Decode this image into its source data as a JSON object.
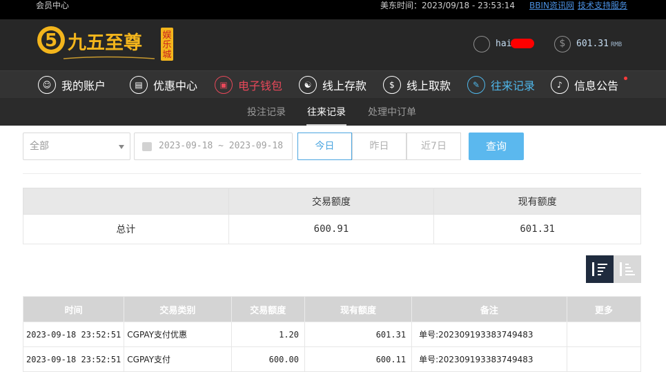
{
  "topbar": {
    "member_center": "会员中心",
    "time_label": "美东时间：2023/09/18 - 23:53:14",
    "link1": "BBIN资讯网",
    "link2": "技术支持服务"
  },
  "header": {
    "brand": "九五至尊",
    "brand_side": "娱乐城",
    "username": "hai",
    "balance": "601.31",
    "balance_unit": "RMB"
  },
  "nav": {
    "items": [
      {
        "label": "我的账户",
        "icon": "user-icon"
      },
      {
        "label": "优惠中心",
        "icon": "gift-icon"
      },
      {
        "label": "电子钱包",
        "icon": "wallet-icon"
      },
      {
        "label": "线上存款",
        "icon": "deposit-icon"
      },
      {
        "label": "线上取款",
        "icon": "withdraw-icon"
      },
      {
        "label": "往来记录",
        "icon": "records-icon"
      },
      {
        "label": "信息公告",
        "icon": "bell-icon"
      }
    ]
  },
  "subnav": {
    "items": [
      "投注记录",
      "往来记录",
      "处理中订单"
    ]
  },
  "filters": {
    "type_select": "全部",
    "date_start": "2023-09-18",
    "date_sep": "~",
    "date_end": "2023-09-18",
    "quick": [
      "今日",
      "昨日",
      "近7日"
    ],
    "query_label": "查询"
  },
  "summary": {
    "headers": [
      "",
      "交易额度",
      "现有额度"
    ],
    "row": {
      "label": "总计",
      "trade": "600.91",
      "current": "601.31"
    }
  },
  "records": {
    "headers": [
      "时间",
      "交易类别",
      "交易额度",
      "现有额度",
      "备注",
      "更多"
    ],
    "rows": [
      {
        "time": "2023-09-18 23:52:51",
        "type": "CGPAY支付优惠",
        "amount": "1.20",
        "balance": "601.31",
        "note": "单号:202309193383749483",
        "more": ""
      },
      {
        "time": "2023-09-18 23:52:51",
        "type": "CGPAY支付",
        "amount": "600.00",
        "balance": "600.11",
        "note": "单号:202309193383749483",
        "more": ""
      }
    ]
  },
  "colors": {
    "nav_active_wallet": "#e8485a",
    "nav_active_records": "#4fb7ea",
    "query_button": "#5bb8ee",
    "sort_active": "#1f2b3e"
  }
}
